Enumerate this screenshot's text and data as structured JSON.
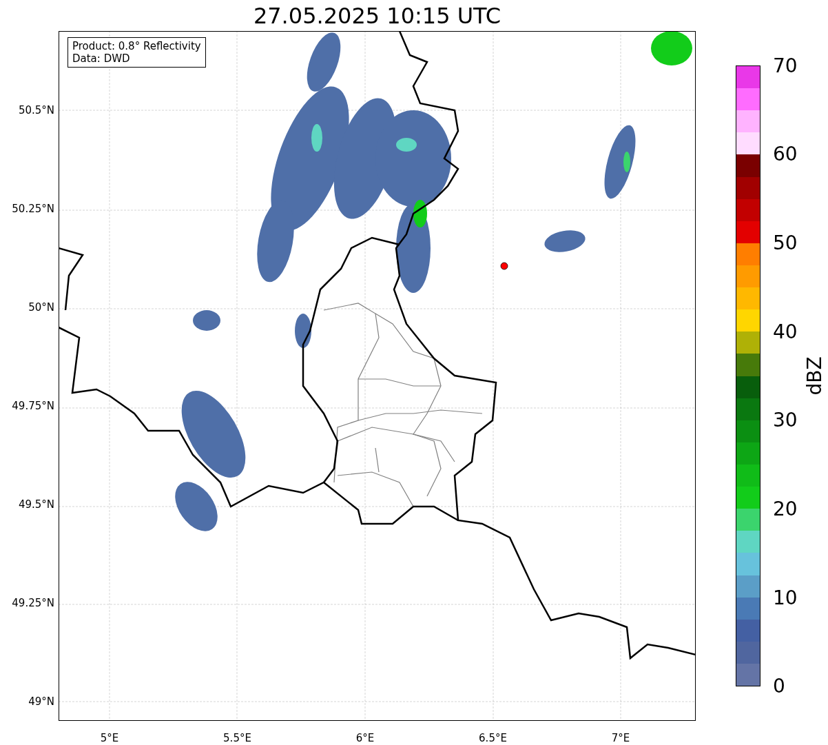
{
  "title": "27.05.2025 10:15 UTC",
  "info_box": [
    "Product: 0.8° Reflectivity",
    "Data: DWD"
  ],
  "y_axis": {
    "ticks": [
      "50.5°N",
      "50.25°N",
      "50°N",
      "49.75°N",
      "49.5°N",
      "49.25°N",
      "49°N"
    ]
  },
  "x_axis": {
    "ticks": [
      "5°E",
      "5.5°E",
      "6°E",
      "6.5°E",
      "7°E"
    ]
  },
  "colorbar": {
    "label": "dBZ",
    "ticks": [
      "70",
      "60",
      "50",
      "40",
      "30",
      "20",
      "10",
      "0"
    ],
    "segments": [
      {
        "color": "#e938e8"
      },
      {
        "color": "#ff6cff"
      },
      {
        "color": "#ffb3ff"
      },
      {
        "color": "#ffdcff"
      },
      {
        "color": "#7a0000"
      },
      {
        "color": "#a10000"
      },
      {
        "color": "#c20000"
      },
      {
        "color": "#e30000"
      },
      {
        "color": "#ff7e00"
      },
      {
        "color": "#ff9b00"
      },
      {
        "color": "#ffb800"
      },
      {
        "color": "#ffd600"
      },
      {
        "color": "#afb106"
      },
      {
        "color": "#477a0a"
      },
      {
        "color": "#085e0c"
      },
      {
        "color": "#0a7810"
      },
      {
        "color": "#0b8f12"
      },
      {
        "color": "#0da615"
      },
      {
        "color": "#10bc18"
      },
      {
        "color": "#12cc1a"
      },
      {
        "color": "#3bd46d"
      },
      {
        "color": "#5fd6c2"
      },
      {
        "color": "#67c2dc"
      },
      {
        "color": "#5b9ec7"
      },
      {
        "color": "#4a7ab5"
      },
      {
        "color": "#4460a3"
      },
      {
        "color": "#50669f"
      },
      {
        "color": "#6474a6"
      }
    ]
  }
}
